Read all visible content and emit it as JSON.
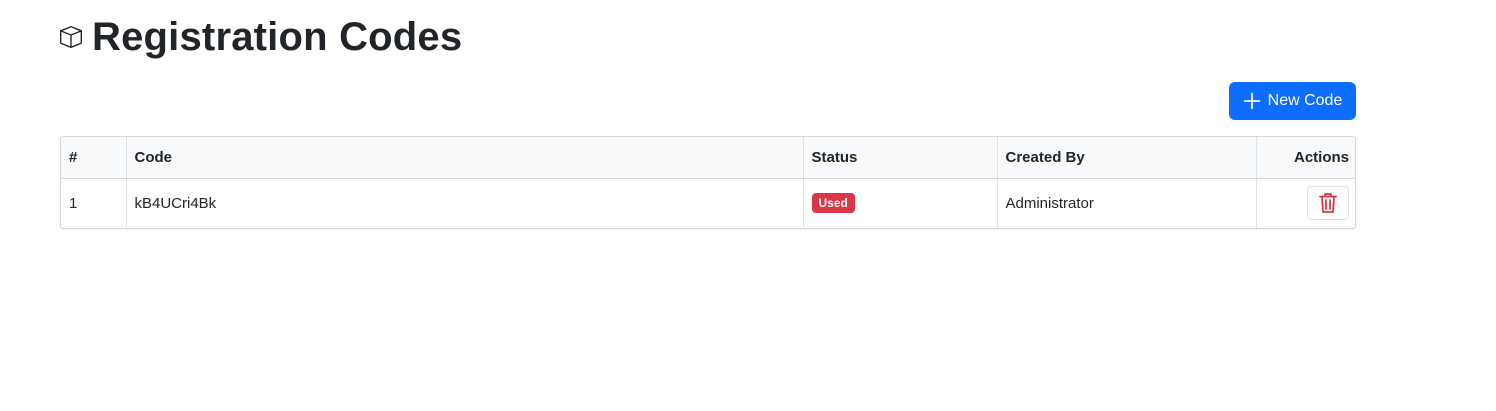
{
  "header": {
    "title": "Registration Codes",
    "icon": "box-icon"
  },
  "toolbar": {
    "new_code_label": "New Code",
    "accent_color": "#0d6efd"
  },
  "table": {
    "columns": [
      "#",
      "Code",
      "Status",
      "Created By",
      "Actions"
    ],
    "rows": [
      {
        "index": "1",
        "code": "kB4UCri4Bk",
        "status": "Used",
        "status_color": "#dc3545",
        "created_by": "Administrator",
        "action_icon": "trash-icon"
      }
    ]
  }
}
